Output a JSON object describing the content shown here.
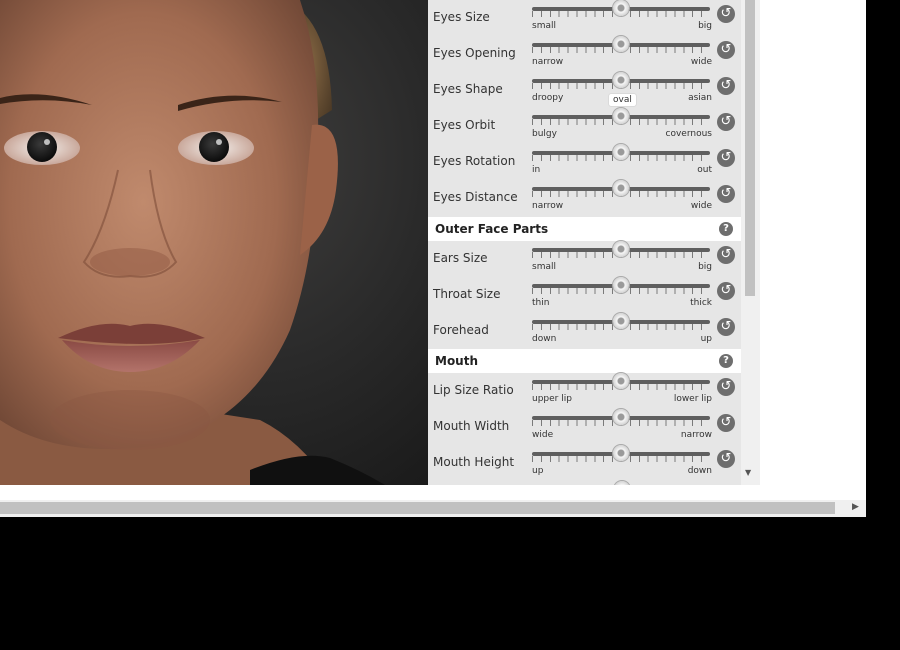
{
  "sliders": [
    {
      "label": "Eyes Size",
      "min": "small",
      "max": "big",
      "value": 0.5
    },
    {
      "label": "Eyes Opening",
      "min": "narrow",
      "max": "wide",
      "value": 0.5
    },
    {
      "label": "Eyes Shape",
      "min": "droopy",
      "max": "asian",
      "value": 0.5
    },
    {
      "label": "Eyes Orbit",
      "min": "bulgy",
      "max": "covernous",
      "value": 0.5
    },
    {
      "label": "Eyes Rotation",
      "min": "in",
      "max": "out",
      "value": 0.5
    },
    {
      "label": "Eyes Distance",
      "min": "narrow",
      "max": "wide",
      "value": 0.5
    },
    {
      "label": "Ears Size",
      "min": "small",
      "max": "big",
      "value": 0.5
    },
    {
      "label": "Throat Size",
      "min": "thin",
      "max": "thick",
      "value": 0.5
    },
    {
      "label": "Forehead",
      "min": "down",
      "max": "up",
      "value": 0.5
    },
    {
      "label": "Lip Size Ratio",
      "min": "upper lip",
      "max": "lower lip",
      "value": 0.5
    },
    {
      "label": "Mouth Width",
      "min": "wide",
      "max": "narrow",
      "value": 0.5
    },
    {
      "label": "Mouth Height",
      "min": "up",
      "max": "down",
      "value": 0.5
    }
  ],
  "sections": {
    "outer_face": "Outer Face Parts",
    "mouth": "Mouth"
  },
  "tooltip": "oval",
  "icons": {
    "reset": "reset-icon",
    "help": "help-icon"
  },
  "colors": {
    "panel_bg": "#e6e6e6",
    "track": "#5f5f5f",
    "button": "#6e6e6e"
  }
}
